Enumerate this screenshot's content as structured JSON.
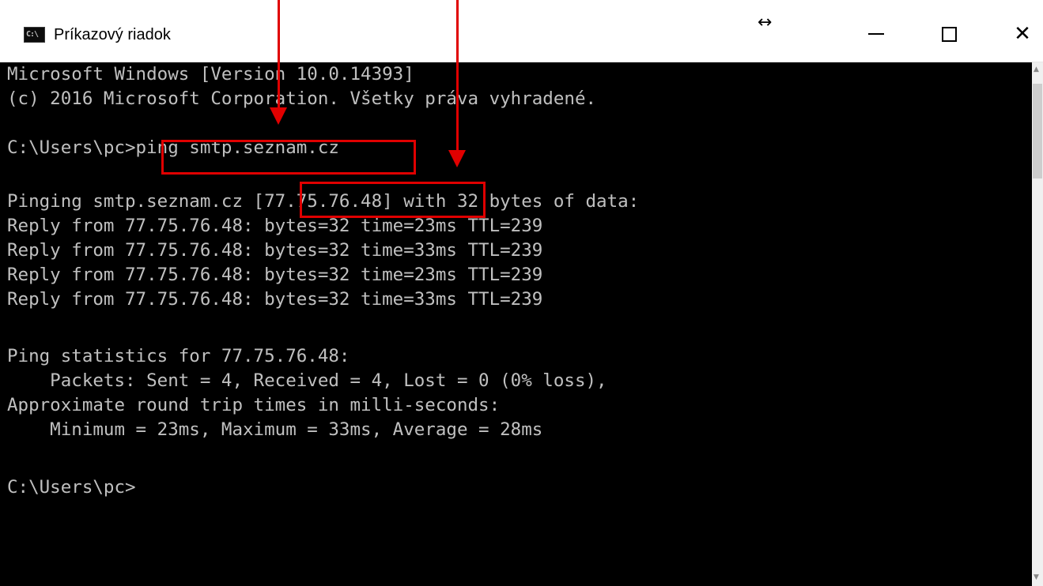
{
  "window": {
    "title": "Príkazový riadok",
    "icon": "console-icon",
    "icon_glyph": "C:\\",
    "resize_glyph": "↔",
    "close_glyph": "✕"
  },
  "console": {
    "lines": [
      "Microsoft Windows [Version 10.0.14393]",
      "(c) 2016 Microsoft Corporation. Všetky práva vyhradené.",
      "",
      "C:\\Users\\pc>ping smtp.seznam.cz",
      "",
      "Pinging smtp.seznam.cz [77.75.76.48] with 32 bytes of data:",
      "Reply from 77.75.76.48: bytes=32 time=23ms TTL=239",
      "Reply from 77.75.76.48: bytes=32 time=33ms TTL=239",
      "Reply from 77.75.76.48: bytes=32 time=23ms TTL=239",
      "Reply from 77.75.76.48: bytes=32 time=33ms TTL=239",
      "",
      "Ping statistics for 77.75.76.48:",
      "    Packets: Sent = 4, Received = 4, Lost = 0 (0% loss),",
      "Approximate round trip times in milli-seconds:",
      "    Minimum = 23ms, Maximum = 33ms, Average = 28ms",
      "",
      "C:\\Users\\pc>"
    ]
  },
  "colors": {
    "console_bg": "#000000",
    "console_text": "#c0c0c0",
    "annotation": "#e00000"
  }
}
